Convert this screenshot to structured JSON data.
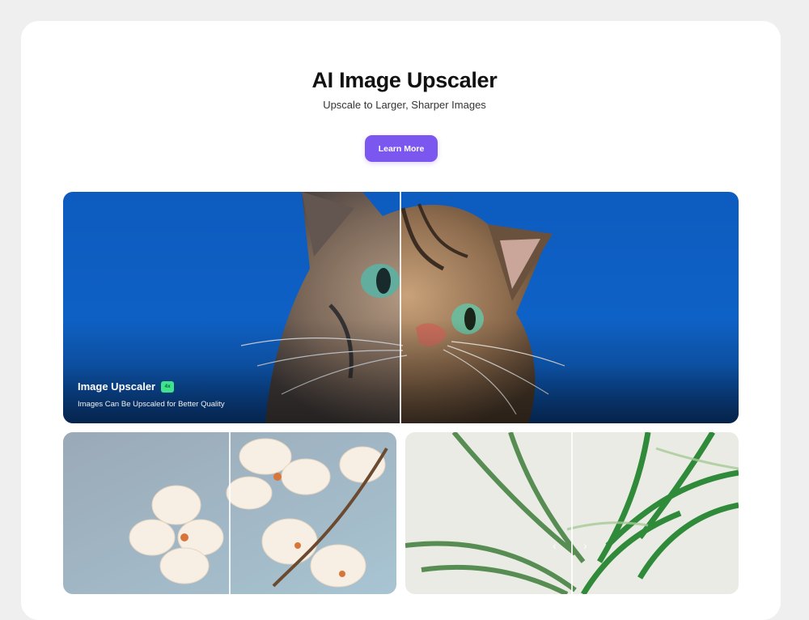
{
  "header": {
    "title": "AI Image Upscaler",
    "subtitle": "Upscale to Larger, Sharper Images",
    "cta_label": "Learn More"
  },
  "hero": {
    "title": "Image Upscaler",
    "badge": "4x",
    "description": "Images Can Be Upscaled for Better Quality"
  },
  "colors": {
    "accent": "#7b57f0",
    "badge": "#3ee38c",
    "sky": "#0f63c8"
  },
  "icons": {
    "prev": "‹",
    "next": "›"
  }
}
